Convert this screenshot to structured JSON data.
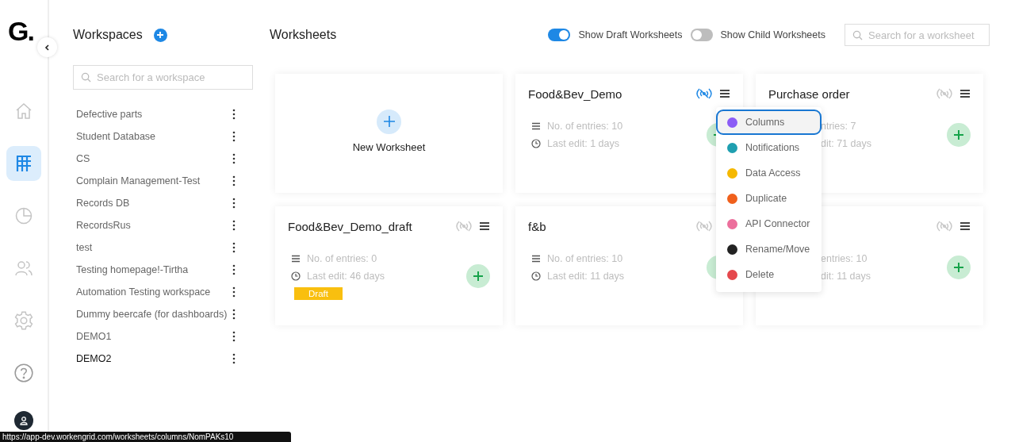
{
  "logo": "G.",
  "rail": {
    "items": [
      {
        "selected": false
      },
      {
        "selected": true
      },
      {
        "selected": false
      },
      {
        "selected": false
      },
      {
        "selected": false
      },
      {
        "selected": false
      }
    ]
  },
  "workspaces": {
    "title": "Workspaces",
    "search": {
      "placeholder": "Search for a workspace"
    },
    "items": [
      {
        "label": "Defective parts",
        "selected": false
      },
      {
        "label": "Student Database",
        "selected": false
      },
      {
        "label": "CS",
        "selected": false
      },
      {
        "label": "Complain Management-Test",
        "selected": false
      },
      {
        "label": "Records DB",
        "selected": false
      },
      {
        "label": "RecordsRus",
        "selected": false
      },
      {
        "label": "test",
        "selected": false
      },
      {
        "label": "Testing homepage!-Tirtha",
        "selected": false
      },
      {
        "label": "Automation Testing workspace",
        "selected": false
      },
      {
        "label": "Dummy beercafe (for dashboards)",
        "selected": false
      },
      {
        "label": "DEMO1",
        "selected": false
      },
      {
        "label": "DEMO2",
        "selected": true
      }
    ]
  },
  "worksheets": {
    "title": "Worksheets",
    "toggles": [
      {
        "label": "Show Draft Worksheets",
        "on": true
      },
      {
        "label": "Show Child Worksheets",
        "on": false
      }
    ],
    "search": {
      "placeholder": "Search for a worksheet"
    },
    "cards": [
      {
        "kind": "new",
        "label": "New Worksheet"
      },
      {
        "kind": "worksheet",
        "title": "Food&Bev_Demo",
        "live": true,
        "entries": "No. of entries: 10",
        "last_edit": "Last edit: 1 days",
        "partly_covered": false,
        "menu": {
          "items": [
            {
              "label": "Columns",
              "color": "#8b5cf6",
              "selected": true
            },
            {
              "label": "Notifications",
              "color": "#1f9fb0",
              "selected": false
            },
            {
              "label": "Data Access",
              "color": "#f5b800",
              "selected": false
            },
            {
              "label": "Duplicate",
              "color": "#f0601c",
              "selected": false
            },
            {
              "label": "API Connector",
              "color": "#ec6f9c",
              "selected": false
            },
            {
              "label": "Rename/Move",
              "color": "#222222",
              "selected": false
            },
            {
              "label": "Delete",
              "color": "#e5484d",
              "selected": false
            }
          ]
        }
      },
      {
        "kind": "worksheet",
        "title": "Purchase order",
        "live": false,
        "entries": "ntries: 7",
        "last_edit": "dit: 71 days",
        "partly_covered": true
      },
      {
        "kind": "worksheet",
        "title": "Food&Bev_Demo_draft",
        "live": false,
        "entries": "No. of entries: 0",
        "last_edit": "Last edit: 46 days",
        "badge": "Draft",
        "partly_covered": false
      },
      {
        "kind": "worksheet",
        "title": "f&b",
        "live": false,
        "entries": "No. of entries: 10",
        "last_edit": "Last edit: 11 days",
        "partly_covered": false
      },
      {
        "kind": "worksheet",
        "live": false,
        "entries": "entries: 10",
        "last_edit": "dit: 11 days",
        "partly_covered": true
      }
    ]
  },
  "status_url": "https://app-dev.workengrid.com/worksheets/columns/NomPAKs10"
}
